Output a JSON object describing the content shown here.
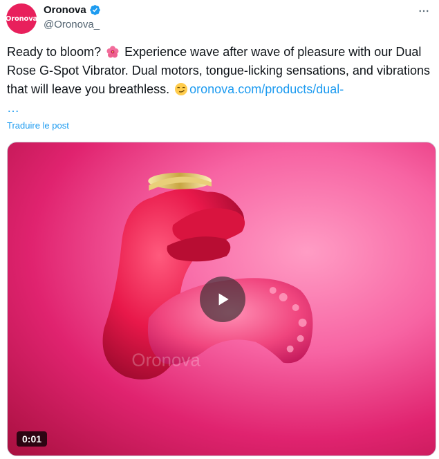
{
  "tweet": {
    "avatar_text": "Oronova",
    "display_name": "Oronova",
    "handle": "@Oronova_",
    "verified": true,
    "text_before_emoji1": "Ready to bloom?",
    "emoji1": "hibiscus-emoji",
    "text_after_emoji1": "Experience wave after wave of pleasure with our Dual Rose G-Spot Vibrator. Dual motors, tongue-licking sensations, and vibrations that will leave you breathless.",
    "emoji2": "smirking-face-emoji",
    "link": "oronova.com/products/dual-",
    "ellipsis": "…",
    "translate_label": "Traduire le post",
    "media": {
      "type": "video",
      "duration": "0:01",
      "watermark": "Oronova"
    }
  },
  "colors": {
    "accent": "#1d9bf0",
    "brand": "#e8205c"
  }
}
